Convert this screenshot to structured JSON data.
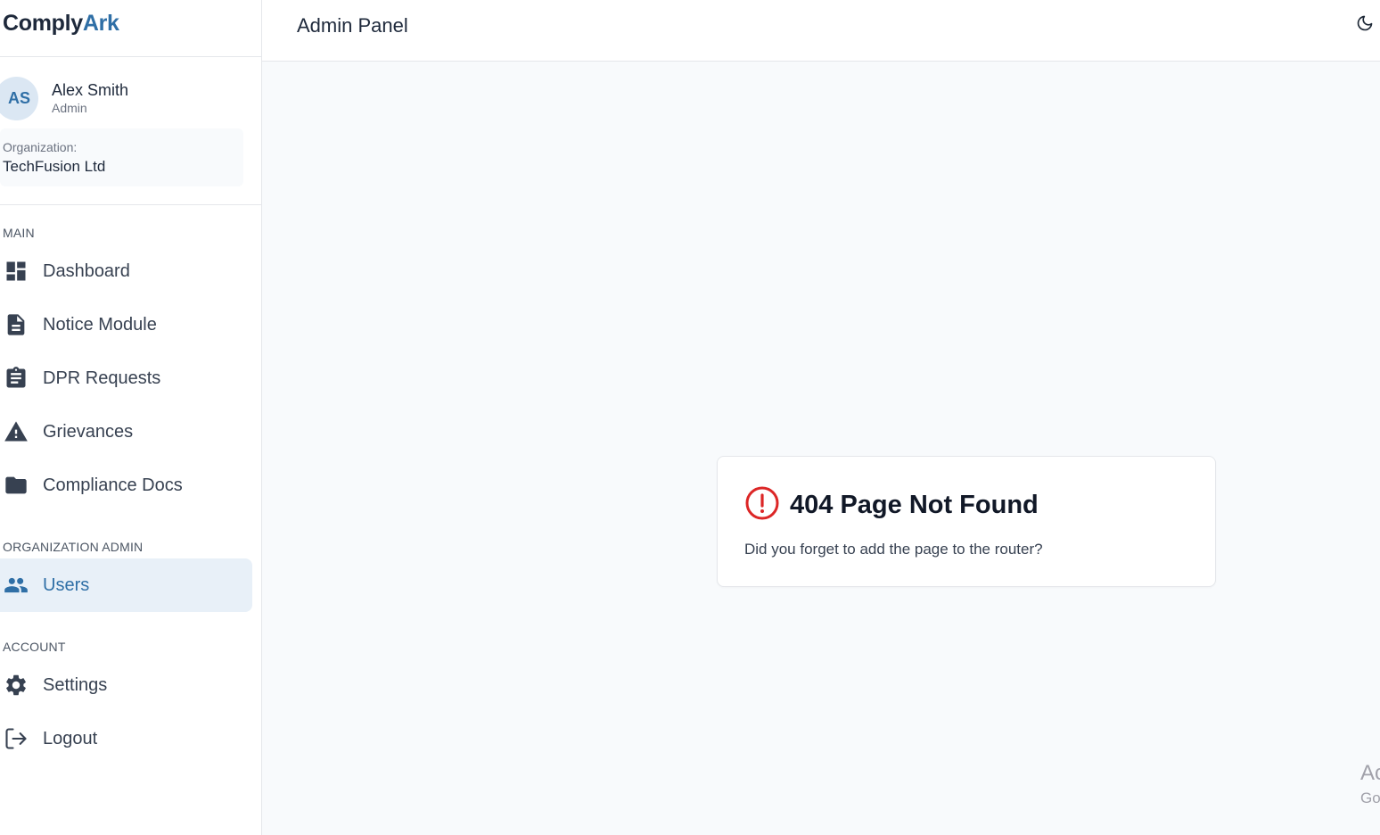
{
  "brand": {
    "part1": "Comply",
    "part2": "Ark"
  },
  "user": {
    "initials": "AS",
    "name": "Alex Smith",
    "role": "Admin",
    "organization_label": "Organization:",
    "organization_name": "TechFusion Ltd"
  },
  "nav": {
    "main_title": "MAIN",
    "main_items": [
      {
        "label": "Dashboard",
        "icon": "dashboard-icon"
      },
      {
        "label": "Notice Module",
        "icon": "document-icon"
      },
      {
        "label": "DPR Requests",
        "icon": "clipboard-icon"
      },
      {
        "label": "Grievances",
        "icon": "warning-icon"
      },
      {
        "label": "Compliance Docs",
        "icon": "folder-icon"
      }
    ],
    "org_admin_title": "ORGANIZATION ADMIN",
    "org_admin_items": [
      {
        "label": "Users",
        "icon": "users-icon",
        "active": true
      }
    ],
    "account_title": "ACCOUNT",
    "account_items": [
      {
        "label": "Settings",
        "icon": "gear-icon"
      },
      {
        "label": "Logout",
        "icon": "logout-icon"
      }
    ]
  },
  "header": {
    "title": "Admin Panel",
    "theme_toggle_icon": "moon-icon"
  },
  "error_card": {
    "icon": "alert-circle-icon",
    "title": "404 Page Not Found",
    "message": "Did you forget to add the page to the router?"
  },
  "watermark": {
    "line1": "Ac",
    "line2": "Go"
  },
  "colors": {
    "accent": "#2f6fa6",
    "active_bg": "#e8f0f8",
    "error": "#dc2626",
    "text_dark": "#1e293b"
  }
}
